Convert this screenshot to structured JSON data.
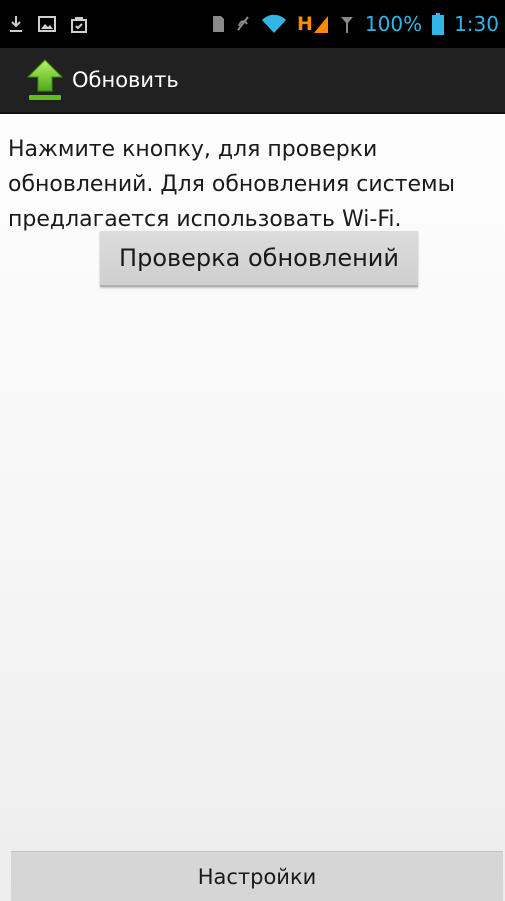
{
  "status_bar": {
    "icons_left": [
      "download-icon",
      "image-icon",
      "shopping-bag-icon"
    ],
    "icons_right": [
      "sd-card-icon",
      "mute-icon",
      "wifi-icon",
      "hspa-signal-icon",
      "signal-icon",
      "battery-icon"
    ],
    "network_label": "H",
    "battery": "100%",
    "time": "1:30",
    "accent_color": "#33b5e5",
    "network_color": "#ff8a00"
  },
  "action_bar": {
    "icon": "update-arrow-icon",
    "title": "Обновить"
  },
  "main": {
    "message": "Нажмите кнопку, для проверки обновлений. Для обновления системы предлагается использовать Wi-Fi.",
    "check_button_label": "Проверка обновлений"
  },
  "footer": {
    "settings_button_label": "Настройки"
  }
}
